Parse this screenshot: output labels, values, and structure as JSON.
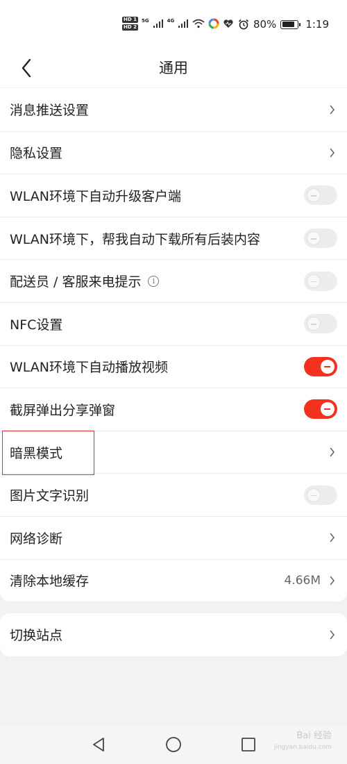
{
  "status_bar": {
    "sim1": "HD 1",
    "sim2": "HD 2",
    "net1": "5G",
    "net2": "4G",
    "battery_percent": "80%",
    "battery_level": 0.8,
    "time": "1:19"
  },
  "header": {
    "title": "通用"
  },
  "settings": [
    {
      "label": "消息推送设置",
      "kind": "chevron"
    },
    {
      "label": "隐私设置",
      "kind": "chevron"
    },
    {
      "label": "WLAN环境下自动升级客户端",
      "kind": "toggle",
      "on": false
    },
    {
      "label": "WLAN环境下，帮我自动下载所有后装内容",
      "kind": "toggle",
      "on": false
    },
    {
      "label": "配送员 / 客服来电提示",
      "kind": "toggle",
      "on": false,
      "info_icon": "info-icon"
    },
    {
      "label": "NFC设置",
      "kind": "toggle",
      "on": false
    },
    {
      "label": "WLAN环境下自动播放视频",
      "kind": "toggle",
      "on": true
    },
    {
      "label": "截屏弹出分享弹窗",
      "kind": "toggle",
      "on": true
    },
    {
      "label": "暗黑模式",
      "kind": "chevron",
      "highlighted": true
    },
    {
      "label": "图片文字识别",
      "kind": "toggle",
      "on": false
    },
    {
      "label": "网络诊断",
      "kind": "chevron"
    },
    {
      "label": "清除本地缓存",
      "kind": "chevron",
      "value": "4.66M"
    }
  ],
  "site": {
    "label": "切换站点"
  },
  "colors": {
    "accent": "#f2311f",
    "highlight_border": "#e0322b",
    "background": "#f2f2f2"
  },
  "watermark": {
    "text": "Bai 经验",
    "sub": "jingyan.baidu.com"
  }
}
